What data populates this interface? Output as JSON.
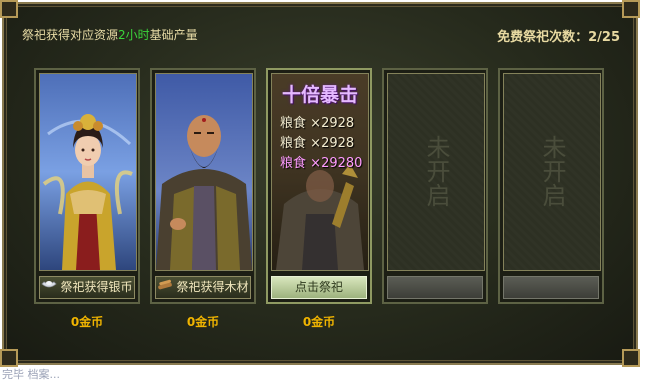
{
  "header": {
    "info_prefix": "祭祀获得对应资源",
    "info_highlight": "2小时",
    "info_suffix": "基础产量",
    "free_label": "免费祭祀次数：",
    "free_value": "2/25"
  },
  "cards": [
    {
      "button_label": "祭祀获得银币",
      "button_icon": "silver-ingot-icon",
      "price": "0金币"
    },
    {
      "button_label": "祭祀获得木材",
      "button_icon": "wood-icon",
      "price": "0金币"
    },
    {
      "button_label": "点击祭祀",
      "price": "0金币",
      "crit_title": "十倍暴击",
      "rewards": [
        {
          "label": "粮食",
          "mult": "×",
          "amount": "2928"
        },
        {
          "label": "粮食",
          "mult": "×",
          "amount": "2928"
        },
        {
          "label": "粮食",
          "mult": "×",
          "amount": "29280"
        }
      ]
    },
    {
      "locked_label": "未开启"
    },
    {
      "locked_label": "未开启"
    }
  ],
  "footer": {
    "text": "完毕 档案..."
  },
  "colors": {
    "accent_green": "#3bd53b",
    "price_gold": "#f0b400",
    "crit_purple": "#e5b9ff",
    "panel_dark": "#262a1c"
  }
}
